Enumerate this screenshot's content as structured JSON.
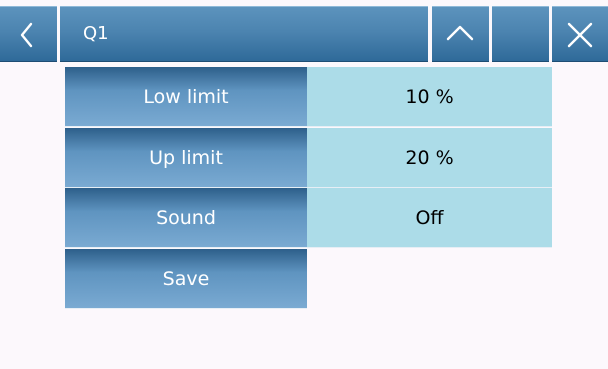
{
  "header": {
    "title": "Q1",
    "back_icon": "chevron-left-icon",
    "up_icon": "chevron-up-icon",
    "close_icon": "close-icon"
  },
  "settings": [
    {
      "label": "Low limit",
      "value": "10 %"
    },
    {
      "label": "Up limit",
      "value": "20 %"
    },
    {
      "label": "Sound",
      "value": "Off"
    }
  ],
  "save_label": "Save",
  "colors": {
    "header_blue": "#4c84b0",
    "button_blue": "#5f94c0",
    "value_cell": "#acdce8",
    "background": "#fcf8fc"
  }
}
